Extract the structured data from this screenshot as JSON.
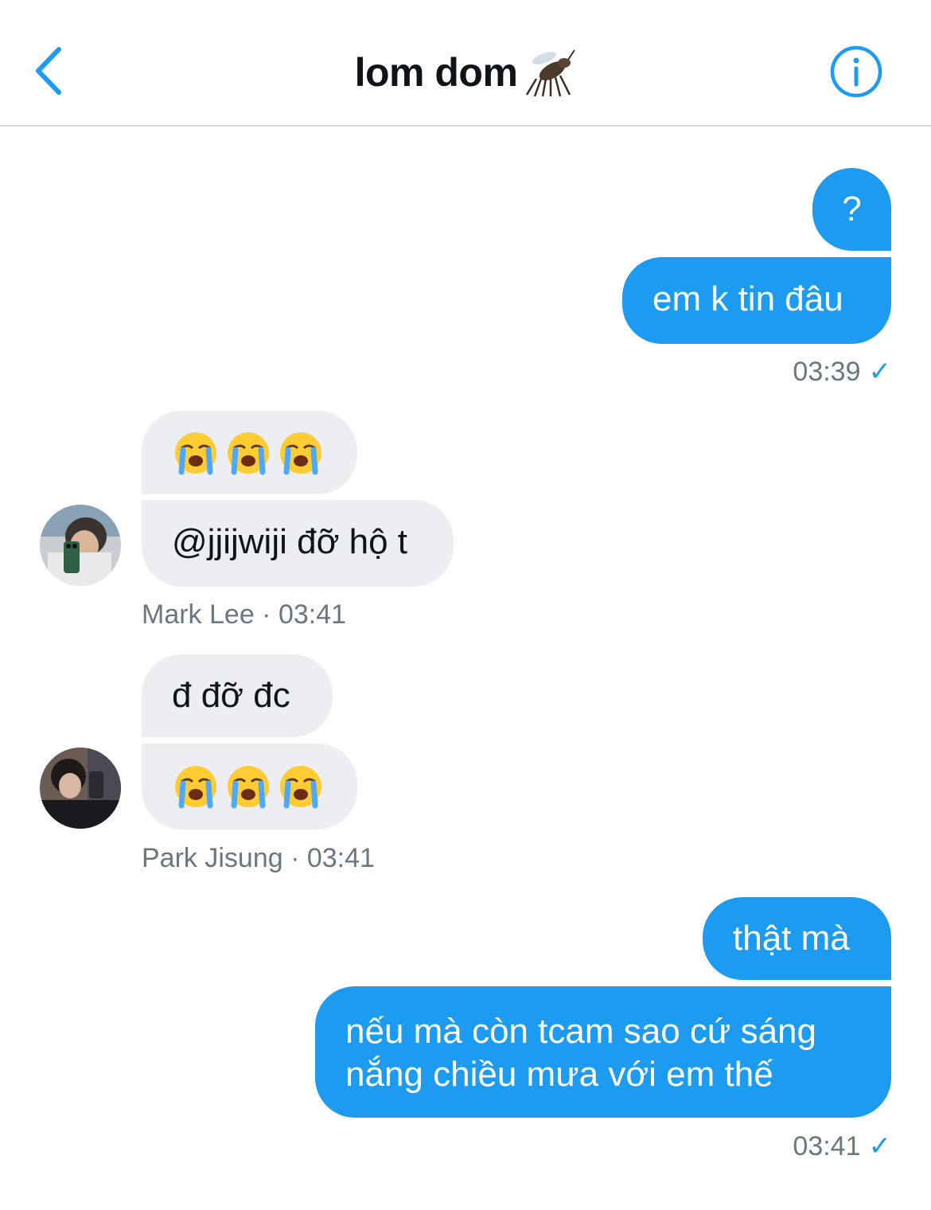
{
  "header": {
    "title": "lom dom",
    "title_icon": "mosquito-icon",
    "back_icon": "chevron-left-icon",
    "info_icon": "info-icon",
    "accent_color": "#1d9bf0"
  },
  "messages": {
    "m1": {
      "text": "?"
    },
    "m2": {
      "text": "em k tin đâu"
    },
    "m2_meta": {
      "time": "03:39",
      "status": "✓"
    },
    "m3": {
      "emoji": [
        "loudly-crying-face",
        "loudly-crying-face",
        "loudly-crying-face"
      ]
    },
    "m4": {
      "text": "@jjijwiji đỡ hộ t"
    },
    "m4_meta": {
      "sender": "Mark Lee",
      "sep": " · ",
      "time": "03:41"
    },
    "m5": {
      "text": "đ đỡ đc"
    },
    "m6": {
      "emoji": [
        "loudly-crying-face",
        "loudly-crying-face",
        "loudly-crying-face"
      ]
    },
    "m6_meta": {
      "sender": "Park Jisung",
      "sep": " · ",
      "time": "03:41"
    },
    "m7": {
      "text": "thật mà"
    },
    "m8": {
      "line1": "nếu mà còn tcam sao cứ sáng",
      "line2": "nắng chiều mưa với em thế"
    },
    "m8_meta": {
      "time": "03:41",
      "status": "✓"
    }
  },
  "colors": {
    "outgoing": "#1d9bf0",
    "incoming": "#eceef1",
    "meta": "#697780"
  }
}
